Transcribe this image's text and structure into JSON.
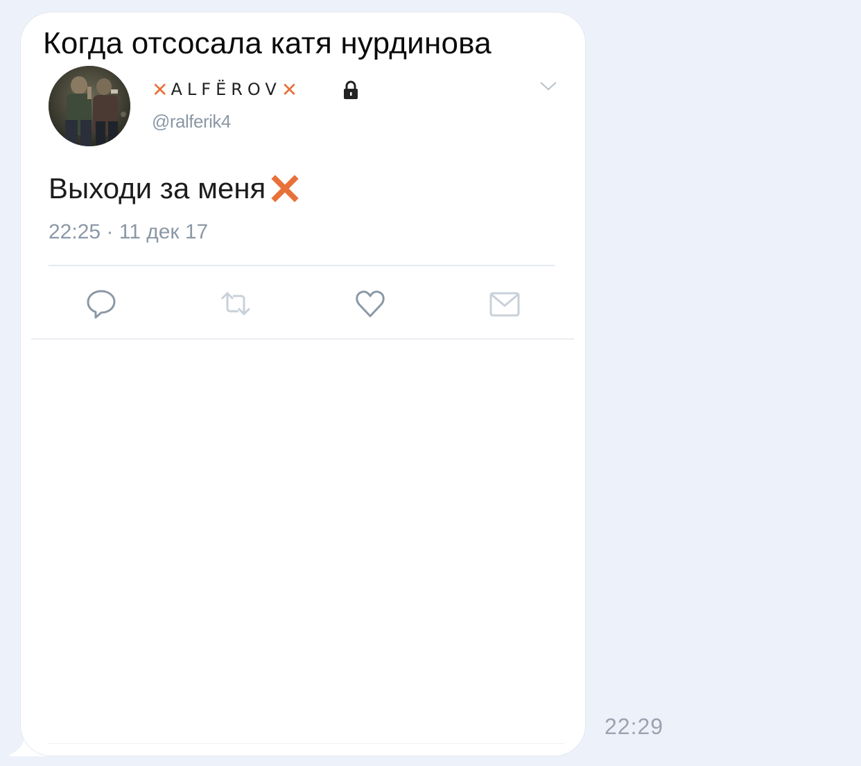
{
  "message": {
    "caption": "Когда отсосала катя нурдинова",
    "time": "22:29"
  },
  "tweet": {
    "display_name": {
      "prefix_mark": "✕",
      "name": "ALFЁROV",
      "suffix_mark": "✕"
    },
    "handle": "@ralferik4",
    "text": "Выходи за меня",
    "timestamp": "22:25 · 11 дек 17",
    "icons": {
      "lock": "lock-icon",
      "menu": "chevron-down-icon",
      "reply": "reply-bubble-icon",
      "retweet": "retweet-icon",
      "like": "heart-icon",
      "dm": "envelope-icon",
      "text_emoji": "cross-mark-icon"
    },
    "colors": {
      "accent": "#e8713a",
      "muted": "#8b98a5",
      "background": "#edf2fa",
      "bubble": "#ffffff"
    }
  }
}
